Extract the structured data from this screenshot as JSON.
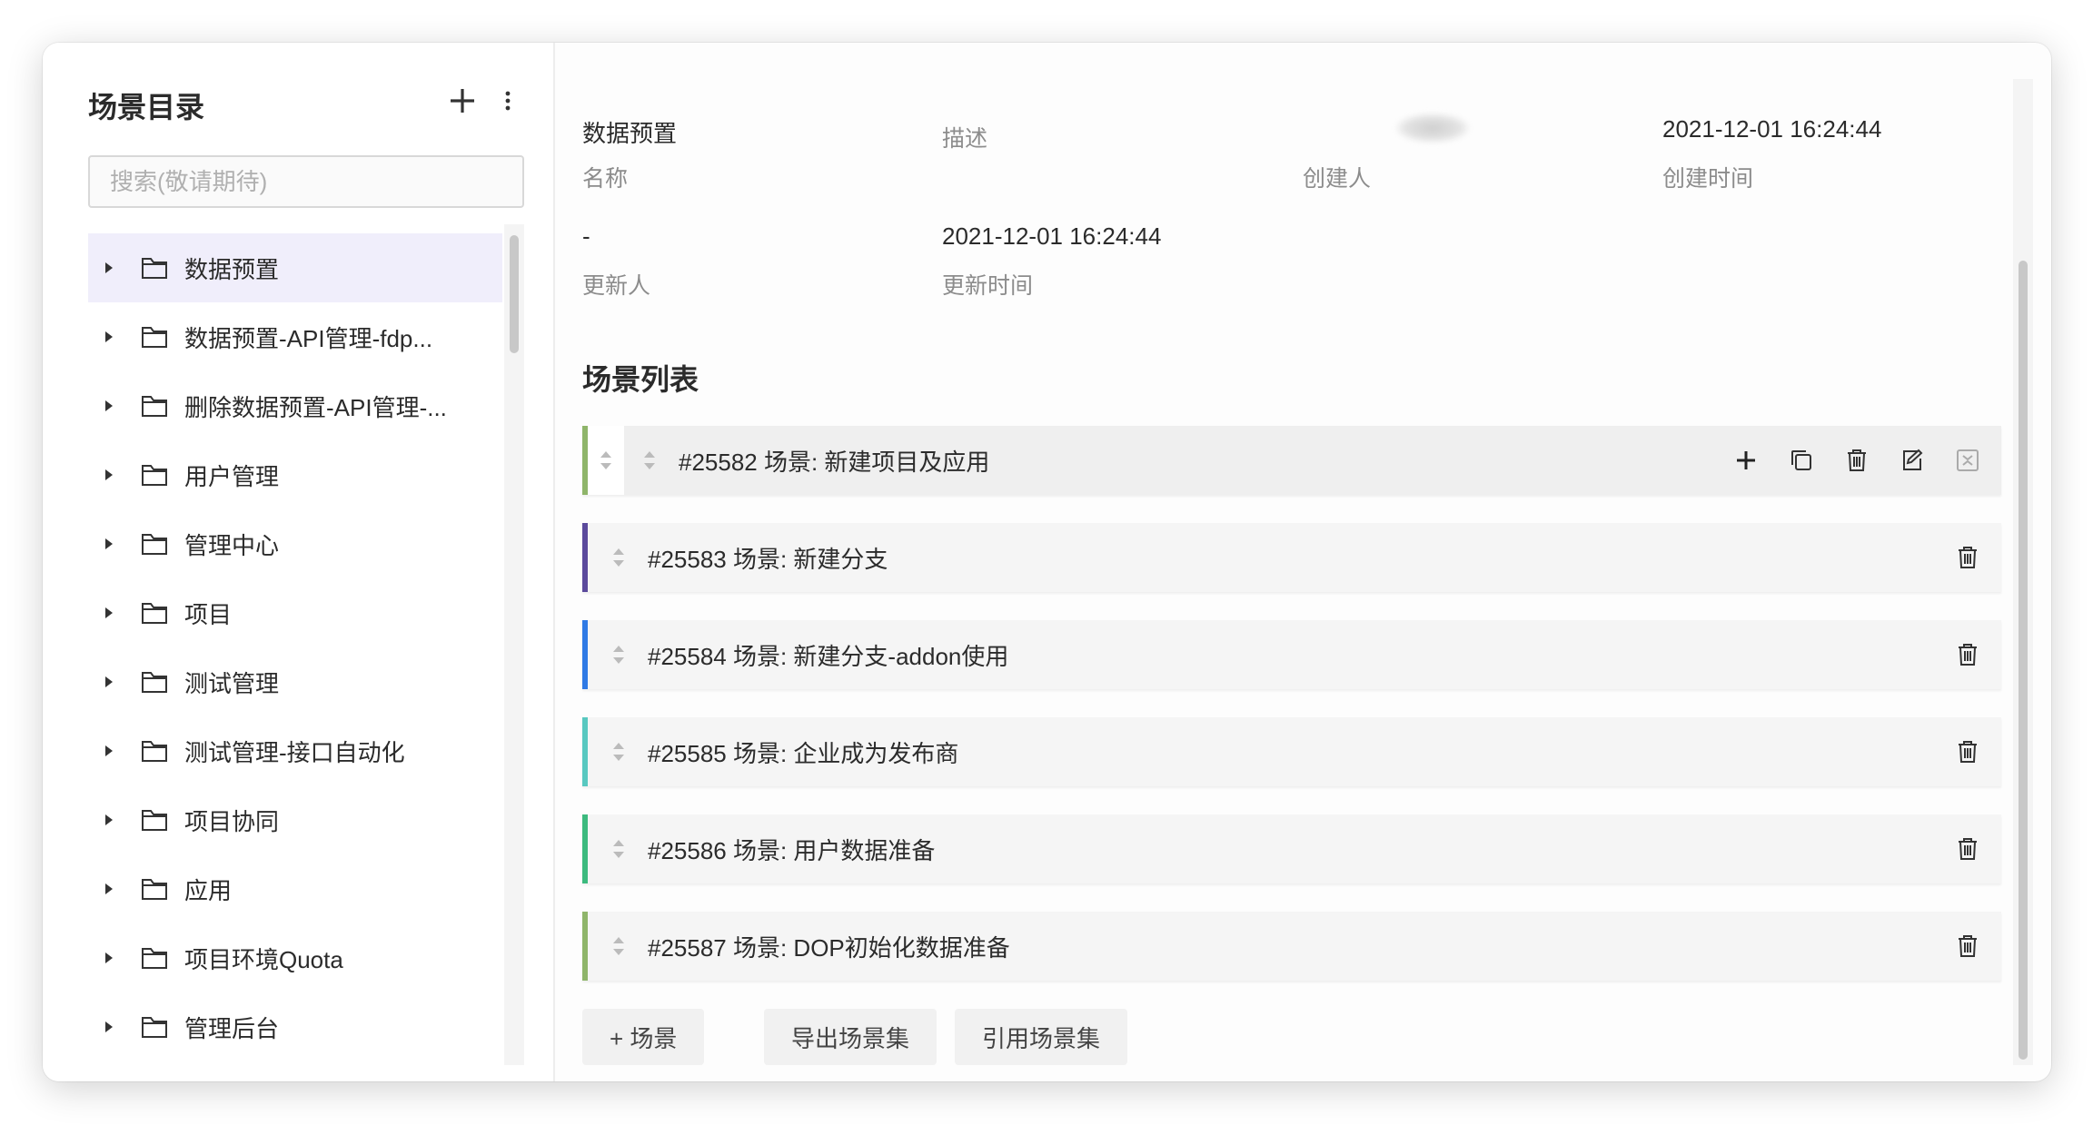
{
  "sidebar": {
    "title": "场景目录",
    "search_placeholder": "搜索(敬请期待)",
    "items": [
      {
        "label": "数据预置",
        "active": true
      },
      {
        "label": "数据预置-API管理-fdp..."
      },
      {
        "label": "删除数据预置-API管理-..."
      },
      {
        "label": "用户管理"
      },
      {
        "label": "管理中心"
      },
      {
        "label": "项目"
      },
      {
        "label": "测试管理"
      },
      {
        "label": "测试管理-接口自动化"
      },
      {
        "label": "项目协同"
      },
      {
        "label": "应用"
      },
      {
        "label": "项目环境Quota"
      },
      {
        "label": "管理后台"
      }
    ]
  },
  "meta": {
    "name_value": "数据预置",
    "name_label": "名称",
    "desc_label": "描述",
    "creator_label": "创建人",
    "created_time_value": "2021-12-01 16:24:44",
    "created_time_label": "创建时间",
    "updater_value": "-",
    "updater_label": "更新人",
    "updated_time_value": "2021-12-01 16:24:44",
    "updated_time_label": "更新时间"
  },
  "scene_list": {
    "title": "场景列表",
    "items": [
      {
        "label": "#25582 场景: 新建项目及应用",
        "color": "#8fb56a"
      },
      {
        "label": "#25583 场景: 新建分支",
        "color": "#5b4a9c"
      },
      {
        "label": "#25584 场景: 新建分支-addon使用",
        "color": "#2f7ae5"
      },
      {
        "label": "#25585 场景: 企业成为发布商",
        "color": "#58c8c0"
      },
      {
        "label": "#25586 场景: 用户数据准备",
        "color": "#3cba7e"
      },
      {
        "label": "#25587 场景: DOP初始化数据准备",
        "color": "#8fb56a"
      }
    ]
  },
  "buttons": {
    "add_scene": "+ 场景",
    "export_set": "导出场景集",
    "ref_set": "引用场景集"
  }
}
